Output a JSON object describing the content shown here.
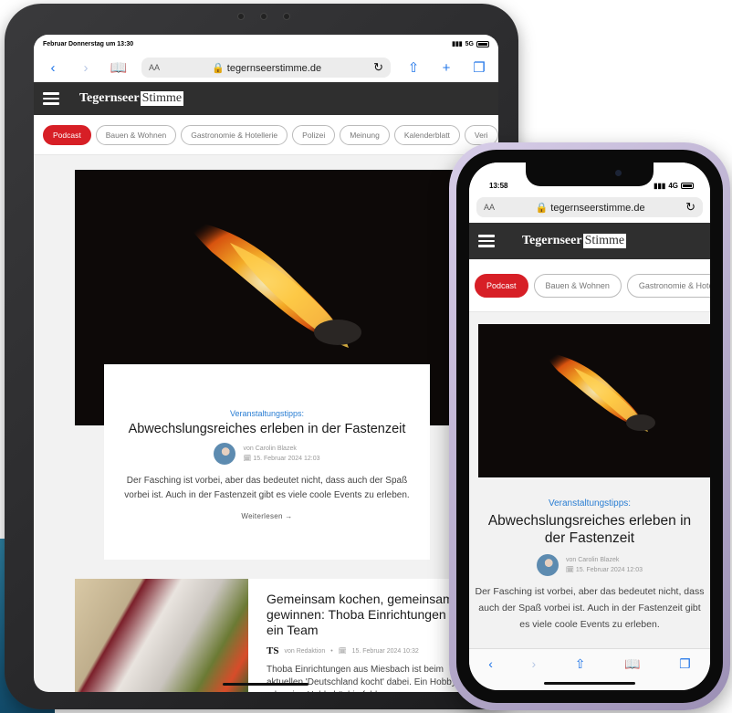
{
  "tablet": {
    "status": {
      "time": "Februar Donnerstag um 13:30",
      "signal": "5G"
    },
    "browser": {
      "aa_label": "AA",
      "url": "tegernseerstimme.de",
      "lock_icon": "lock-icon",
      "reload_icon": "reload-icon"
    },
    "site": {
      "logo_part1": "Tegernseer",
      "logo_part2": "Stimme"
    },
    "categories": [
      "Podcast",
      "Bauen & Wohnen",
      "Gastronomie & Hotellerie",
      "Polizei",
      "Meinung",
      "Kalenderblatt",
      "Veri"
    ],
    "featured": {
      "kicker": "Veranstaltungstipps:",
      "title": "Abwechslungsreiches erleben in der Fastenzeit",
      "author": "von Carolin Blazek",
      "date": "15. Februar 2024 12:03",
      "excerpt": "Der Fasching ist vorbei, aber das bedeutet nicht, dass auch der Spaß vorbei ist. Auch in der Fastenzeit gibt es viele coole Events zu erleben.",
      "read_more": "Weiterlesen →"
    },
    "article2": {
      "title": "Gemeinsam kochen, gemeinsam gewinnen: Thoba Einrichtungen sucht ein Team",
      "author_logo": "TS",
      "author": "von Redaktion",
      "separator": "•",
      "date": "15. Februar 2024 10:32",
      "excerpt": "Thoba Einrichtungen aus Miesbach ist beim aktuellen 'Deutschland kocht' dabei. Ein Hobbykoch oder eine Hobbyköchin fehlen"
    }
  },
  "phone": {
    "status": {
      "time": "13:58",
      "signal": "4G"
    },
    "browser": {
      "aa_label": "AA",
      "url": "tegernseerstimme.de"
    },
    "site": {
      "logo_part1": "Tegernseer",
      "logo_part2": "Stimme"
    },
    "categories": [
      "Podcast",
      "Bauen & Wohnen",
      "Gastronomie & Hotelle"
    ],
    "featured": {
      "kicker": "Veranstaltungstipps:",
      "title": "Abwechslungsreiches erleben in der Fastenzeit",
      "author": "von Carolin Blazek",
      "date": "15. Februar 2024 12:03",
      "excerpt": "Der Fasching ist vorbei, aber das bedeutet nicht, dass auch der Spaß vorbei ist. Auch in der Fastenzeit gibt es viele coole Events zu erleben."
    }
  },
  "colors": {
    "accent_red": "#d71f26",
    "kicker_blue": "#2a7ed3",
    "site_bar": "#2f2f2f",
    "ios_blue": "#1f74e8"
  }
}
